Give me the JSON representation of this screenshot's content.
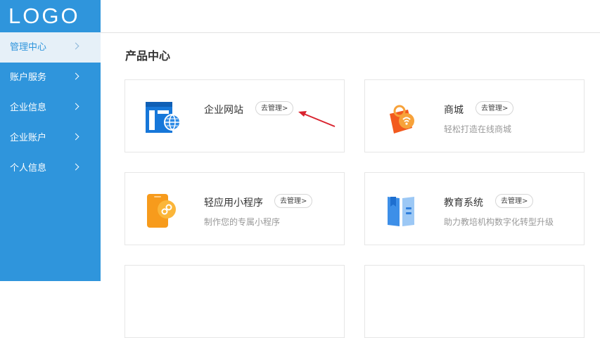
{
  "sidebar": {
    "logo": "LOGO",
    "items": [
      {
        "label": "管理中心",
        "active": true
      },
      {
        "label": "账户服务"
      },
      {
        "label": "企业信息"
      },
      {
        "label": "企业账户"
      },
      {
        "label": "个人信息"
      }
    ]
  },
  "main": {
    "section_title": "产品中心",
    "cards": [
      {
        "title": "企业网站",
        "button": "去管理>",
        "desc": "",
        "icon": "website-icon"
      },
      {
        "title": "商城",
        "button": "去管理>",
        "desc": "轻松打造在线商城",
        "icon": "shopping-bag-icon"
      },
      {
        "title": "轻应用小程序",
        "button": "去管理>",
        "desc": "制作您的专属小程序",
        "icon": "mini-program-icon"
      },
      {
        "title": "教育系统",
        "button": "去管理>",
        "desc": "助力教培机构数字化转型升级",
        "icon": "education-book-icon"
      }
    ]
  },
  "colors": {
    "sidebar": "#2f95dc",
    "active_bg": "#e6f0f8",
    "arrow": "#d9232e"
  }
}
